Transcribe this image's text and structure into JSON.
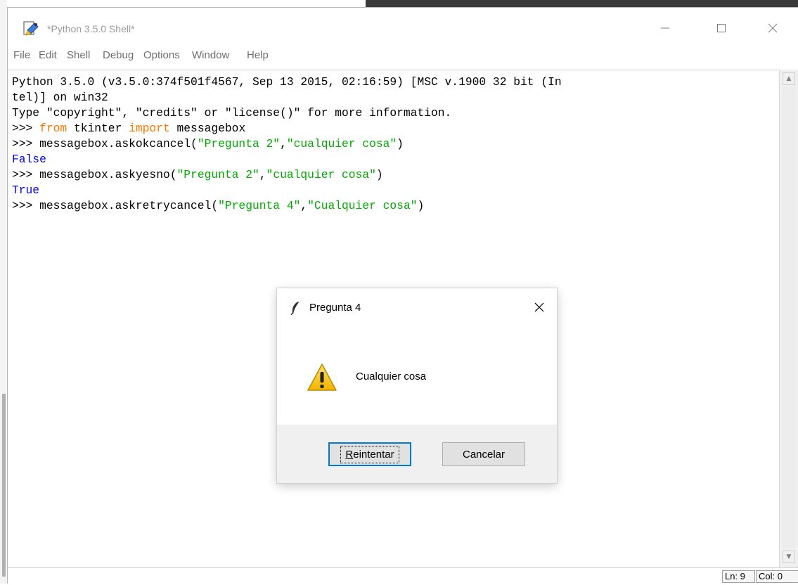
{
  "window": {
    "title": "*Python 3.5.0 Shell*"
  },
  "menu": [
    "File",
    "Edit",
    "Shell",
    "Debug",
    "Options",
    "Window",
    "Help"
  ],
  "editor": {
    "line1": "Python 3.5.0 (v3.5.0:374f501f4567, Sep 13 2015, 02:16:59) [MSC v.1900 32 bit (In",
    "line2": "tel)] on win32",
    "line3": "Type \"copyright\", \"credits\" or \"license()\" for more information.",
    "line4": {
      "prompt": ">>> ",
      "kw1": "from",
      "mid": " tkinter ",
      "kw2": "import",
      "tail": " messagebox"
    },
    "line5": {
      "prompt": ">>> ",
      "call": "messagebox.askokcancel(",
      "s1": "\"Pregunta 2\"",
      "comma": ",",
      "s2": "\"cualquier cosa\"",
      "close": ")"
    },
    "line6": "False",
    "line7": {
      "prompt": ">>> ",
      "call": "messagebox.askyesno(",
      "s1": "\"Pregunta 2\"",
      "comma": ",",
      "s2": "\"cualquier cosa\"",
      "close": ")"
    },
    "line8": "True",
    "line9": {
      "prompt": ">>> ",
      "call": "messagebox.askretrycancel(",
      "s1": "\"Pregunta 4\"",
      "comma": ",",
      "s2": "\"Cualquier cosa\"",
      "close": ")"
    }
  },
  "status": {
    "ln": "Ln: 9",
    "col": "Col: 0"
  },
  "dialog": {
    "title": "Pregunta 4",
    "message": "Cualquier cosa",
    "retry_first": "R",
    "retry_rest": "eintentar",
    "cancel": "Cancelar"
  },
  "icons": {
    "app": "idle-icon",
    "dialog": "feather-icon",
    "warning": "warning-icon"
  }
}
